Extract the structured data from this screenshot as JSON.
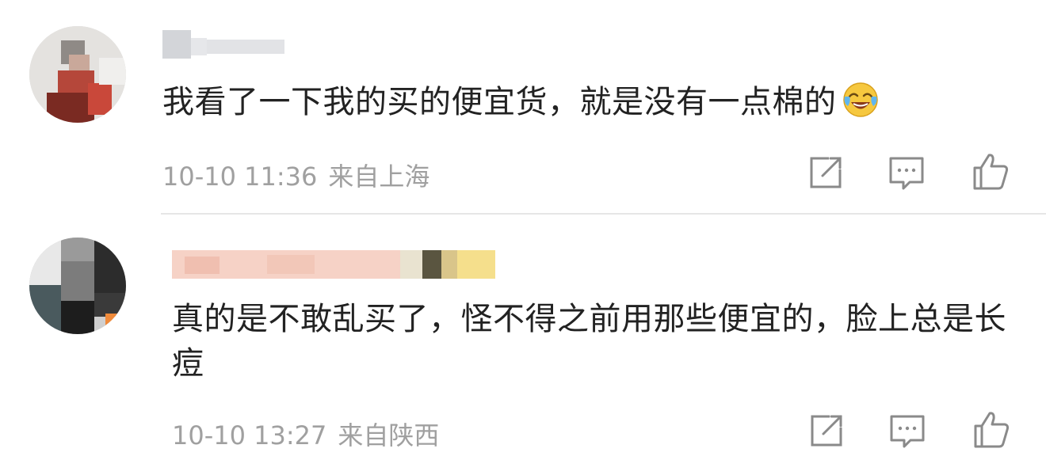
{
  "comments": [
    {
      "username": "",
      "text": "我看了一下我的买的便宜货，就是没有一点棉的",
      "emoji": "laughing-crying-emoji",
      "time": "10-10 11:36",
      "location": "来自上海",
      "actions": [
        "share-icon",
        "reply-icon",
        "like-icon"
      ]
    },
    {
      "username": "",
      "text": "真的是不敢乱买了，怪不得之前用那些便宜的，脸上总是长痘",
      "emoji": "",
      "time": "10-10 13:27",
      "location": "来自陕西",
      "actions": [
        "share-icon",
        "reply-icon",
        "like-icon"
      ]
    }
  ],
  "colors": {
    "text": "#222222",
    "meta": "#a0a0a0",
    "icon": "#8a8a8a",
    "divider": "#e6e6e6"
  }
}
